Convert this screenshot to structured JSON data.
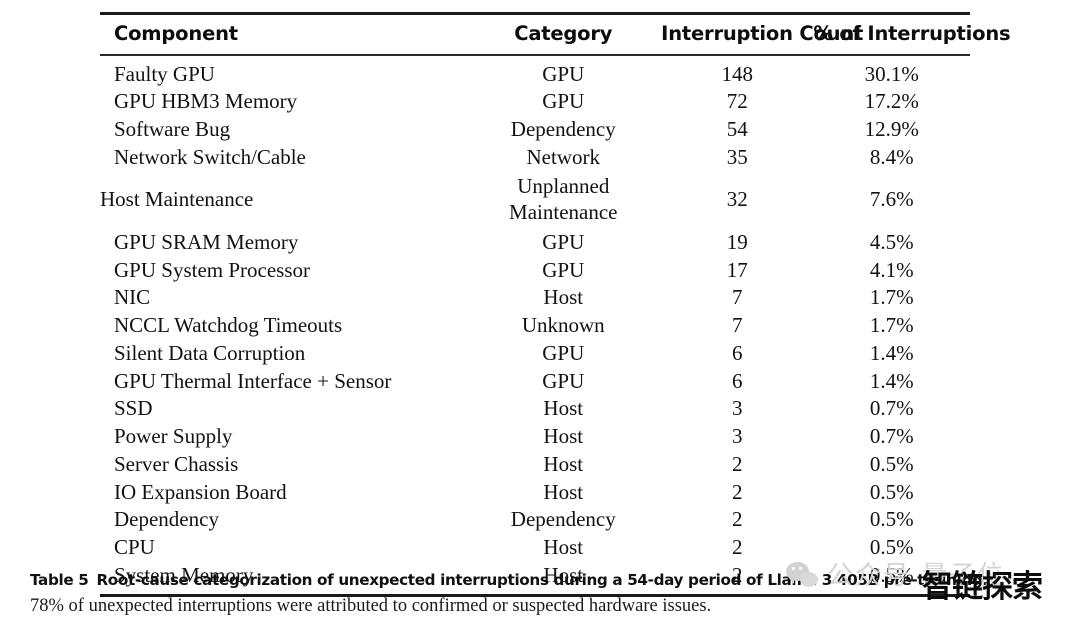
{
  "table": {
    "columns": [
      {
        "key": "component",
        "label": "Component"
      },
      {
        "key": "category",
        "label": "Category"
      },
      {
        "key": "count",
        "label": "Interruption Count"
      },
      {
        "key": "percent",
        "label": "% of Interruptions"
      }
    ],
    "rows": [
      {
        "component": "Faulty GPU",
        "category": "GPU",
        "count": "148",
        "percent": "30.1%"
      },
      {
        "component": "GPU HBM3 Memory",
        "category": "GPU",
        "count": "72",
        "percent": "17.2%"
      },
      {
        "component": "Software Bug",
        "category": "Dependency",
        "count": "54",
        "percent": "12.9%"
      },
      {
        "component": "Network Switch/Cable",
        "category": "Network",
        "count": "35",
        "percent": "8.4%"
      },
      {
        "component": "Host Maintenance",
        "category": "Unplanned Maintenance",
        "category_line1": "Unplanned",
        "category_line2": "Maintenance",
        "count": "32",
        "percent": "7.6%"
      },
      {
        "component": "GPU SRAM Memory",
        "category": "GPU",
        "count": "19",
        "percent": "4.5%"
      },
      {
        "component": "GPU System Processor",
        "category": "GPU",
        "count": "17",
        "percent": "4.1%"
      },
      {
        "component": "NIC",
        "category": "Host",
        "count": "7",
        "percent": "1.7%"
      },
      {
        "component": "NCCL Watchdog Timeouts",
        "category": "Unknown",
        "count": "7",
        "percent": "1.7%"
      },
      {
        "component": "Silent Data Corruption",
        "category": "GPU",
        "count": "6",
        "percent": "1.4%"
      },
      {
        "component": "GPU Thermal Interface + Sensor",
        "category": "GPU",
        "count": "6",
        "percent": "1.4%"
      },
      {
        "component": "SSD",
        "category": "Host",
        "count": "3",
        "percent": "0.7%"
      },
      {
        "component": "Power Supply",
        "category": "Host",
        "count": "3",
        "percent": "0.7%"
      },
      {
        "component": "Server Chassis",
        "category": "Host",
        "count": "2",
        "percent": "0.5%"
      },
      {
        "component": "IO Expansion Board",
        "category": "Host",
        "count": "2",
        "percent": "0.5%"
      },
      {
        "component": "Dependency",
        "category": "Dependency",
        "count": "2",
        "percent": "0.5%"
      },
      {
        "component": "CPU",
        "category": "Host",
        "count": "2",
        "percent": "0.5%"
      },
      {
        "component": "System Memory",
        "category": "Host",
        "count": "2",
        "percent": "0.5%"
      }
    ]
  },
  "caption": {
    "label": "Table 5",
    "line1": "Root-cause categorization of unexpected interruptions during a 54-day period of Llama 3 405B pre-training.",
    "line2": "78% of unexpected interruptions were attributed to confirmed or suspected hardware issues."
  },
  "watermarks": {
    "gray_text": "公众号 量子位",
    "gray_icon": "wechat-logo-icon",
    "black_text": "智链探索"
  }
}
